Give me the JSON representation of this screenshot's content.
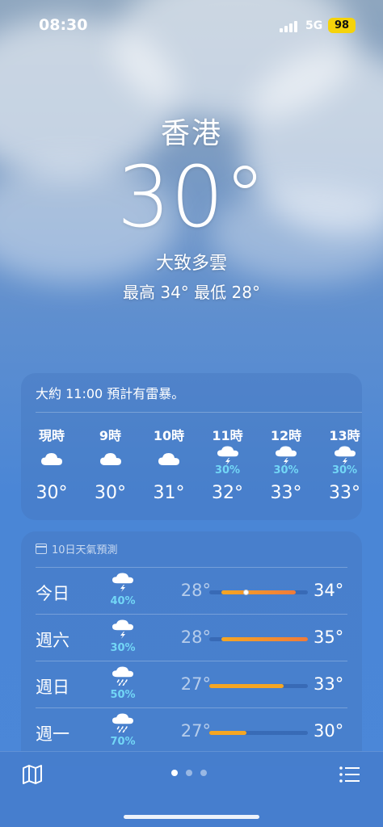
{
  "status_bar": {
    "time": "08:30",
    "network": "5G",
    "battery": "98"
  },
  "current": {
    "city": "香港",
    "temperature": "30°",
    "condition": "大致多雲",
    "high_low": "最高 34°  最低 28°"
  },
  "hourly": {
    "summary": "大約 11:00 預計有雷暴。",
    "hours": [
      {
        "label": "現時",
        "icon": "cloud-icon",
        "precip": "",
        "temp": "30°"
      },
      {
        "label": "9時",
        "icon": "cloud-icon",
        "precip": "",
        "temp": "30°"
      },
      {
        "label": "10時",
        "icon": "cloud-icon",
        "precip": "",
        "temp": "31°"
      },
      {
        "label": "11時",
        "icon": "thunderstorm-icon",
        "precip": "30%",
        "temp": "32°"
      },
      {
        "label": "12時",
        "icon": "thunderstorm-icon",
        "precip": "30%",
        "temp": "33°"
      },
      {
        "label": "13時",
        "icon": "thunderstorm-icon",
        "precip": "30%",
        "temp": "33°"
      }
    ]
  },
  "daily": {
    "title": "10日天氣預測",
    "range": [
      27,
      35
    ],
    "days": [
      {
        "day": "今日",
        "icon": "thunderstorm-icon",
        "precip": "40%",
        "low": "28°",
        "high": "34°",
        "low_val": 28,
        "high_val": 34,
        "current": 30
      },
      {
        "day": "週六",
        "icon": "thunderstorm-icon",
        "precip": "30%",
        "low": "28°",
        "high": "35°",
        "low_val": 28,
        "high_val": 35
      },
      {
        "day": "週日",
        "icon": "rain-icon",
        "precip": "50%",
        "low": "27°",
        "high": "33°",
        "low_val": 27,
        "high_val": 33
      },
      {
        "day": "週一",
        "icon": "rain-icon",
        "precip": "70%",
        "low": "27°",
        "high": "30°",
        "low_val": 27,
        "high_val": 30
      }
    ]
  },
  "colors": {
    "precip": "#72d6f6",
    "bar_orange": "#f07b3a",
    "bar_yellow": "#f5a623"
  },
  "pager": {
    "count": 3,
    "active": 0
  }
}
